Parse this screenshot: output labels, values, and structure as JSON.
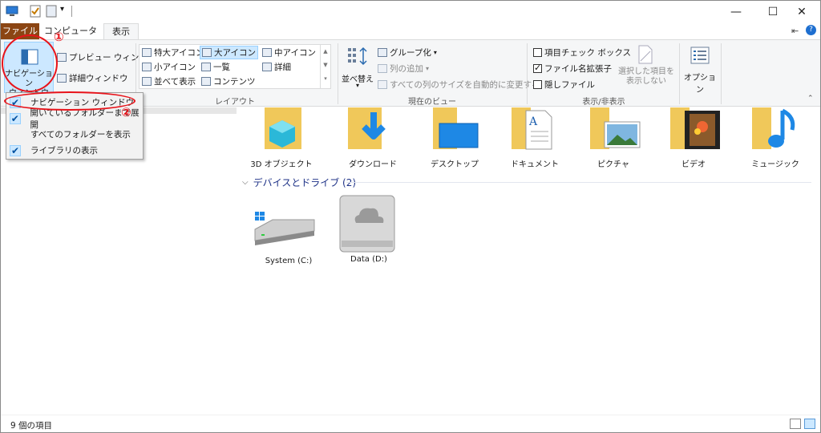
{
  "window": {
    "minimize_glyph": "—",
    "maximize_glyph": "☐",
    "close_glyph": "✕",
    "quick_access_dropdown_glyph": "▾",
    "help_glyph": "?",
    "pin_glyph": "⇤",
    "collapse_glyph": "⌃"
  },
  "tabs": {
    "file": "ファイル",
    "computer": "コンピューター",
    "view": "表示"
  },
  "ribbon": {
    "panes": {
      "nav_pane_line1": "ナビゲーション",
      "nav_pane_line2": "ウィンドウ",
      "preview_pane": "プレビュー ウィンドウ",
      "details_pane": "詳細ウィンドウ"
    },
    "layout": {
      "extra_large": "特大アイコン",
      "large": "大アイコン",
      "medium": "中アイコン",
      "small": "小アイコン",
      "list": "一覧",
      "details": "詳細",
      "tiles": "並べて表示",
      "content": "コンテンツ",
      "group_label": "レイアウト"
    },
    "current_view": {
      "sort_line1": "並べ替え",
      "group_by": "グループ化",
      "add_columns": "列の追加",
      "size_all_columns": "すべての列のサイズを自動的に変更する",
      "group_label": "現在のビュー"
    },
    "show_hide": {
      "item_checkboxes": "項目チェック ボックス",
      "file_extensions": "ファイル名拡張子",
      "hidden_items": "隠しファイル",
      "hide_selected_line1": "選択した項目を",
      "hide_selected_line2": "表示しない",
      "group_label": "表示/非表示"
    },
    "options": "オプション"
  },
  "dropdown": {
    "items": [
      {
        "label": "ナビゲーション ウィンドウ",
        "checked": true
      },
      {
        "label": "開いているフォルダーまで展開",
        "checked": true
      },
      {
        "label": "すべてのフォルダーを表示",
        "checked": false
      },
      {
        "label": "ライブラリの表示",
        "checked": true
      }
    ]
  },
  "annotations": {
    "one": "①",
    "two": "②"
  },
  "folders": [
    {
      "label": "3D オブジェクト",
      "icon": "3d-objects-icon"
    },
    {
      "label": "ダウンロード",
      "icon": "downloads-icon"
    },
    {
      "label": "デスクトップ",
      "icon": "desktop-icon"
    },
    {
      "label": "ドキュメント",
      "icon": "documents-icon"
    },
    {
      "label": "ピクチャ",
      "icon": "pictures-icon"
    },
    {
      "label": "ビデオ",
      "icon": "videos-icon"
    },
    {
      "label": "ミュージック",
      "icon": "music-icon"
    }
  ],
  "drives_section": {
    "title": "デバイスとドライブ (2)"
  },
  "drives": [
    {
      "label": "System (C:)",
      "icon": "system-drive-icon"
    },
    {
      "label": "Data (D:)",
      "icon": "data-drive-icon"
    }
  ],
  "status": {
    "items_count": "9 個の項目"
  },
  "colors": {
    "file_tab": "#8b4513",
    "annotation_red": "#e8131a",
    "selection": "#cce8ff",
    "section_title": "#1e3287"
  }
}
